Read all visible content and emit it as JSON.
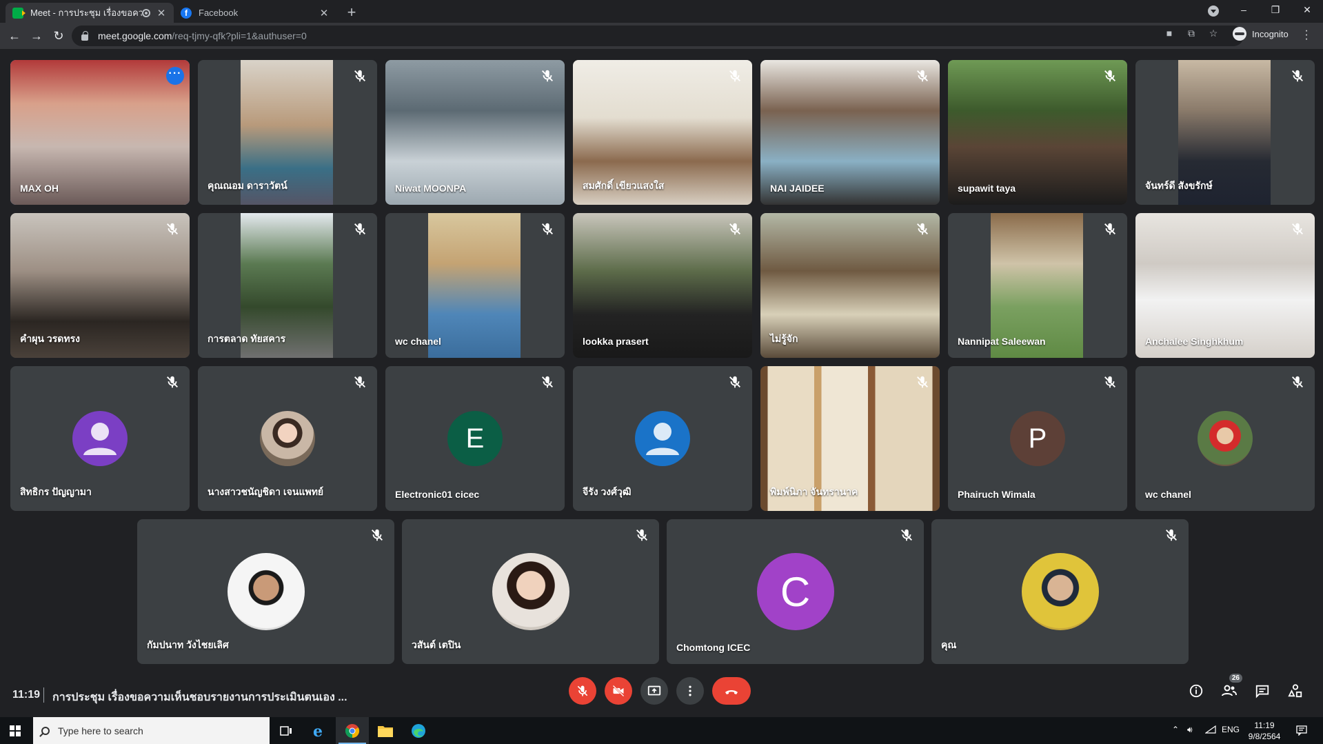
{
  "browser": {
    "tabs": [
      {
        "title": "Meet - การประชุม เรื่องขอความเ",
        "favicon": "google-meet-icon",
        "active": true,
        "recording_indicator": true
      },
      {
        "title": "Facebook",
        "favicon": "facebook-icon",
        "active": false
      }
    ],
    "new_tab": "+",
    "window_controls": {
      "minimize": "–",
      "restore": "❐",
      "close": "✕"
    },
    "url_host": "meet.google.com",
    "url_path": "/req-tjmy-qfk?pli=1&authuser=0",
    "profile_label": "Incognito"
  },
  "meet": {
    "tiles_row1": [
      {
        "name": "MAX OH",
        "pinned_menu": true
      },
      {
        "name": "คุณณอม ดาราวัตน์"
      },
      {
        "name": "Niwat MOONPA"
      },
      {
        "name": "สมศักดิ์ เขียวแสงใส"
      },
      {
        "name": "NAI JAIDEE"
      },
      {
        "name": "supawit taya"
      },
      {
        "name": "จันทร์ดี สังขรักษ์"
      }
    ],
    "tiles_row2": [
      {
        "name": "คำผุน วรดทรง"
      },
      {
        "name": "การตลาด ทัยสคาร"
      },
      {
        "name": "wc chanel"
      },
      {
        "name": "lookka prasert"
      },
      {
        "name": "ไม่รู้จัก"
      },
      {
        "name": "Nannipat Saleewan"
      },
      {
        "name": "Anchalee Singhkhum"
      }
    ],
    "tiles_row3": [
      {
        "name": "สิทธิกร ปัญญามา",
        "avatar_type": "default-person",
        "avatar_color": "#7b3fc4"
      },
      {
        "name": "นางสาวชนัญชิดา เจนแพทย์",
        "avatar_type": "photo"
      },
      {
        "name": "Electronic01 cicec",
        "avatar_type": "letter",
        "avatar_letter": "E",
        "avatar_color": "#0b5e45"
      },
      {
        "name": "จีรัง วงศ์วุฒิ",
        "avatar_type": "default-person",
        "avatar_color": "#1a73c8"
      },
      {
        "name": "พิมพ์นิภา จันทรานาค",
        "avatar_type": "video"
      },
      {
        "name": "Phairuch Wimala",
        "avatar_type": "letter",
        "avatar_letter": "P",
        "avatar_color": "#5d4037"
      },
      {
        "name": "wc chanel",
        "avatar_type": "photo"
      }
    ],
    "tiles_row4": [
      {
        "name": "กัมปนาท วังไชยเลิศ",
        "avatar_type": "photo"
      },
      {
        "name": "วสันต์ เตปิน",
        "avatar_type": "photo"
      },
      {
        "name": "Chomtong ICEC",
        "avatar_type": "letter",
        "avatar_letter": "C",
        "avatar_color": "#a142c8"
      },
      {
        "name": "คุณ",
        "avatar_type": "photo"
      }
    ],
    "bottom_bar": {
      "time": "11:19",
      "meeting_title": "การประชุม เรื่องขอความเห็นชอบรายงานการประเมินตนเอง ...",
      "participants_count": "26"
    },
    "colors": {
      "hangup": "#ea4335",
      "tile": "#3c4043",
      "background": "#202124",
      "active_outline": "#8ab4f8"
    }
  },
  "taskbar": {
    "search_placeholder": "Type here to search",
    "language": "ENG",
    "clock_time": "11:19",
    "clock_date": "9/8/2564"
  }
}
